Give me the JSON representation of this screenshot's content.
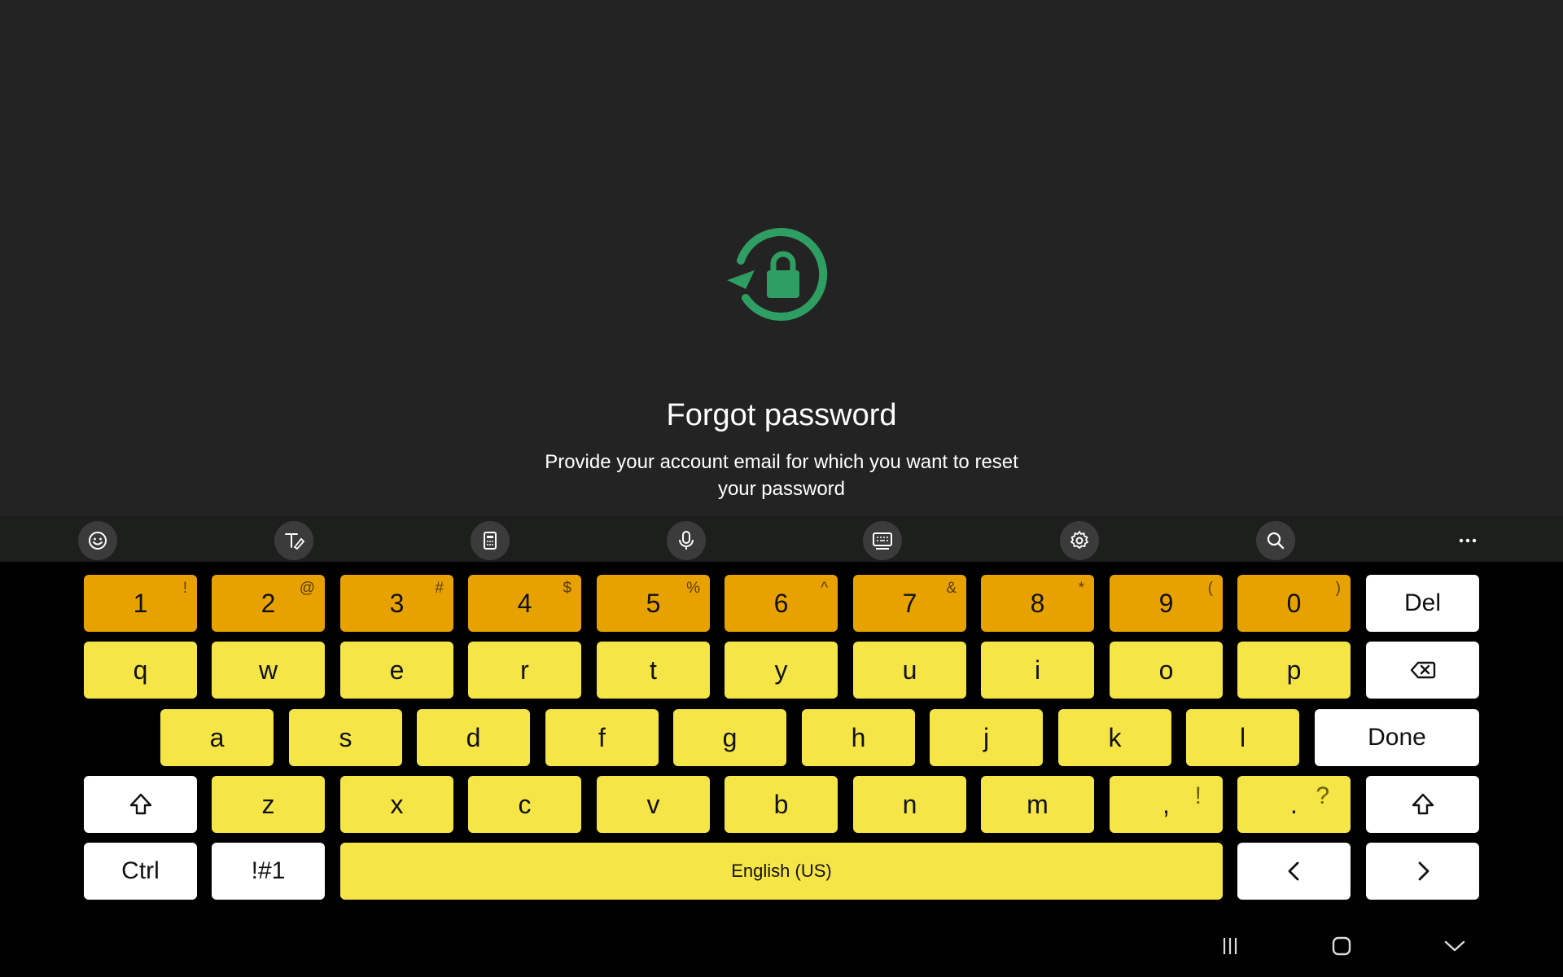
{
  "page": {
    "title": "Forgot password",
    "subtitle": "Provide your account email for which you want to reset your password",
    "icon": "lock-reset-icon",
    "accent_color": "#2e9e62"
  },
  "keyboard_toolbar": {
    "items": [
      "emoji-icon",
      "handwriting-icon",
      "calculator-icon",
      "microphone-icon",
      "keyboard-icon",
      "settings-icon",
      "search-icon",
      "more-icon"
    ]
  },
  "keyboard": {
    "colors": {
      "number_keys": "#e8a200",
      "letter_keys": "#f5e547",
      "function_keys": "#ffffff",
      "background": "#000000"
    },
    "number_row": [
      {
        "label": "1",
        "hint": "!"
      },
      {
        "label": "2",
        "hint": "@"
      },
      {
        "label": "3",
        "hint": "#"
      },
      {
        "label": "4",
        "hint": "$"
      },
      {
        "label": "5",
        "hint": "%"
      },
      {
        "label": "6",
        "hint": "^"
      },
      {
        "label": "7",
        "hint": "&"
      },
      {
        "label": "8",
        "hint": "*"
      },
      {
        "label": "9",
        "hint": "("
      },
      {
        "label": "0",
        "hint": ")"
      }
    ],
    "del_label": "Del",
    "row_q": [
      "q",
      "w",
      "e",
      "r",
      "t",
      "y",
      "u",
      "i",
      "o",
      "p"
    ],
    "row_a": [
      "a",
      "s",
      "d",
      "f",
      "g",
      "h",
      "j",
      "k",
      "l"
    ],
    "done_label": "Done",
    "row_z": [
      "z",
      "x",
      "c",
      "v",
      "b",
      "n",
      "m"
    ],
    "comma": {
      "label": ",",
      "hint": "!"
    },
    "period": {
      "label": ".",
      "hint": "?"
    },
    "ctrl_label": "Ctrl",
    "symbols_label": "!#1",
    "space_label": "English (US)"
  },
  "navbar": {
    "items": [
      "recent-apps-icon",
      "home-icon",
      "hide-keyboard-icon"
    ]
  }
}
